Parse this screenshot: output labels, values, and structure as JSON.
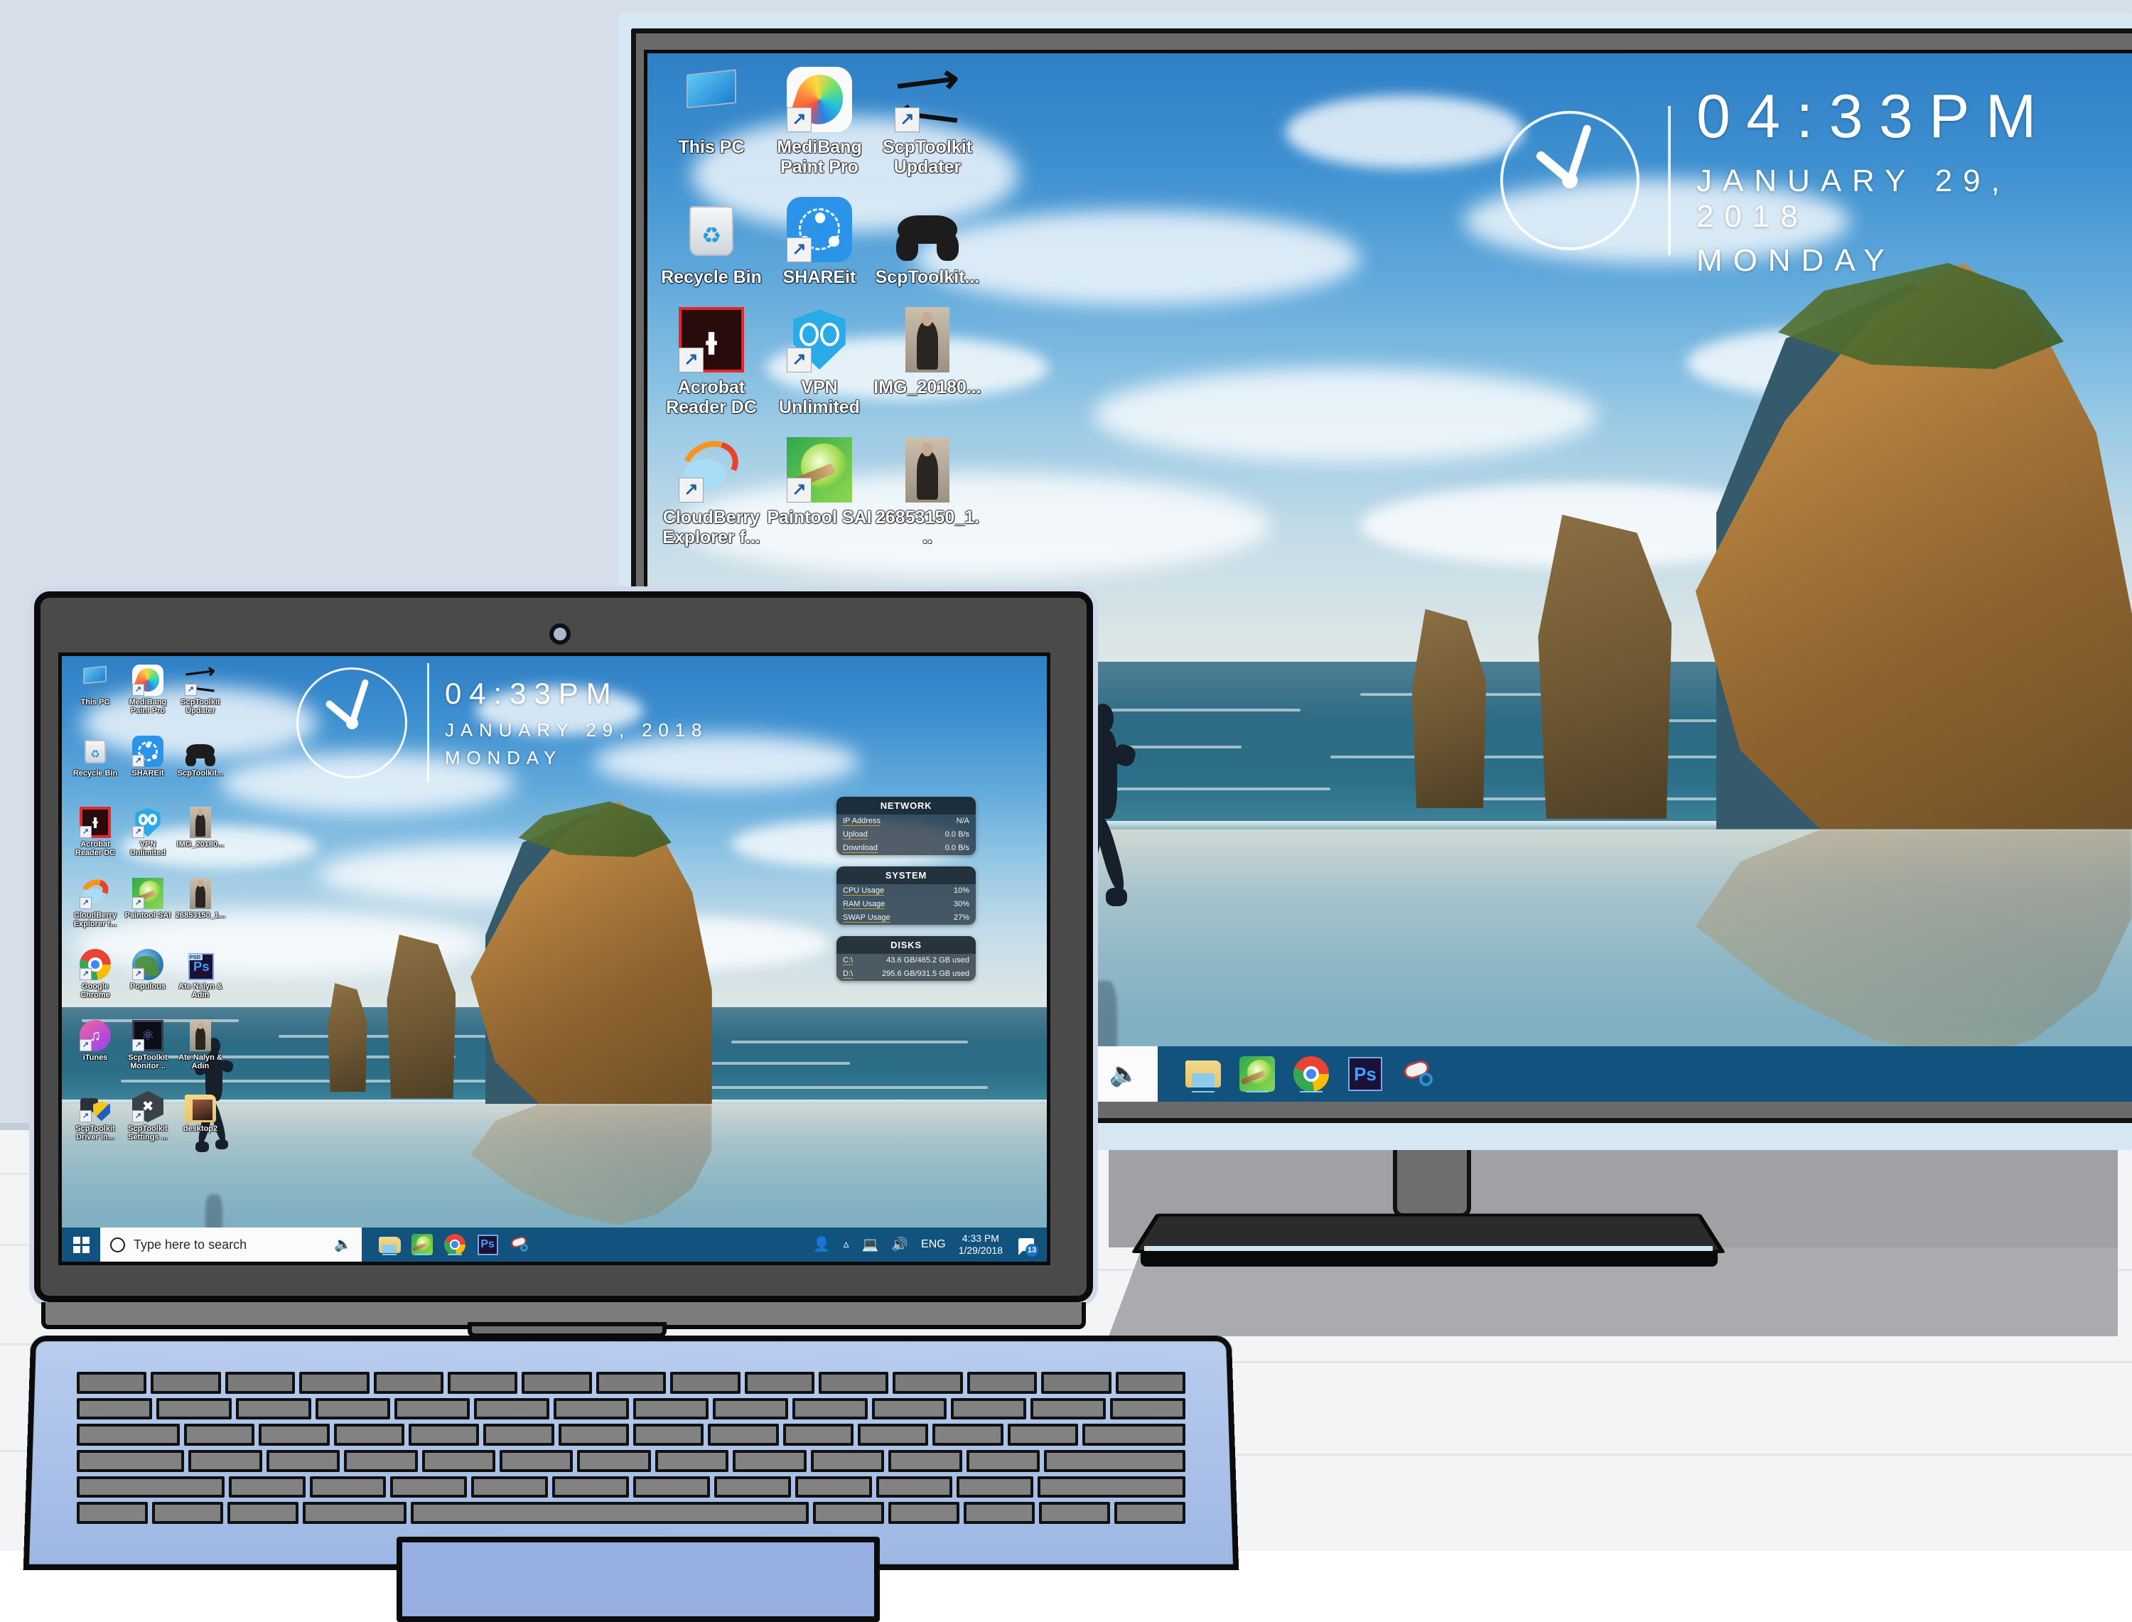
{
  "scene": {
    "title": "Windows 10 desktop mirrored on external monitor and laptop",
    "wall_color": "#d6dfe9",
    "desk_color": "#f3f4f6",
    "laptop_chassis_color": "#b9ccee",
    "taskbar_color": "#12527e",
    "wallpaper_name": "Wharariki Beach"
  },
  "clock_widget": {
    "time": "04:33",
    "ampm": "PM",
    "time_full": "04:33PM",
    "date": "JANUARY 29, 2018",
    "date_partial": "JANUARY",
    "day": "MONDAY"
  },
  "desktop_icons": [
    {
      "label": "This PC",
      "icon": "this-pc-icon",
      "shortcut": false
    },
    {
      "label": "MediBang Paint Pro",
      "icon": "medibang-paint-pro-icon",
      "shortcut": true
    },
    {
      "label": "ScpToolkit Updater",
      "icon": "scptoolkit-updater-icon",
      "shortcut": true
    },
    {
      "label": "Recycle Bin",
      "icon": "recycle-bin-icon",
      "shortcut": false
    },
    {
      "label": "SHAREit",
      "icon": "shareit-icon",
      "shortcut": true
    },
    {
      "label": "ScpToolkit...",
      "icon": "gamepad-icon",
      "shortcut": false
    },
    {
      "label": "Acrobat Reader DC",
      "icon": "acrobat-reader-dc-icon",
      "shortcut": true
    },
    {
      "label": "VPN Unlimited",
      "icon": "vpn-unlimited-icon",
      "shortcut": true
    },
    {
      "label": "IMG_20180...",
      "icon": "photo-thumbnail-icon",
      "shortcut": false
    },
    {
      "label": "CloudBerry Explorer f...",
      "icon": "cloudberry-explorer-icon",
      "shortcut": true
    },
    {
      "label": "Paintool SAI",
      "icon": "paintool-sai-icon",
      "shortcut": true
    },
    {
      "label": "26853150_1...",
      "icon": "photo-thumbnail-icon",
      "shortcut": false
    },
    {
      "label": "Google Chrome",
      "icon": "google-chrome-icon",
      "shortcut": true
    },
    {
      "label": "Populous",
      "icon": "populous-icon",
      "shortcut": true
    },
    {
      "label": "Ate Nalyn & Adin",
      "icon": "photoshop-psd-file-icon",
      "shortcut": false
    },
    {
      "label": "iTunes",
      "icon": "itunes-icon",
      "shortcut": true
    },
    {
      "label": "ScpToolkit Monitor ..",
      "icon": "scptoolkit-monitor-icon",
      "shortcut": true
    },
    {
      "label": "Ate Nalyn & Adin",
      "icon": "photo-thumbnail-icon",
      "shortcut": false
    },
    {
      "label": "ScpToolkit Driver In...",
      "icon": "scptoolkit-driver-installer-icon",
      "shortcut": true
    },
    {
      "label": "ScpToolkit Settings ...",
      "icon": "scptoolkit-settings-icon",
      "shortcut": true
    },
    {
      "label": "desktop2",
      "icon": "folder-icon",
      "shortcut": false
    }
  ],
  "system_monitor": {
    "panels": [
      {
        "title": "NETWORK",
        "rows": [
          {
            "key": "IP Address",
            "value": "N/A"
          },
          {
            "key": "Upload",
            "value": "0.0 B/s"
          },
          {
            "key": "Download",
            "value": "0.0 B/s"
          }
        ]
      },
      {
        "title": "SYSTEM",
        "rows": [
          {
            "key": "CPU Usage",
            "value": "10%"
          },
          {
            "key": "RAM Usage",
            "value": "30%"
          },
          {
            "key": "SWAP Usage",
            "value": "27%"
          }
        ]
      },
      {
        "title": "DISKS",
        "rows": [
          {
            "key": "C:\\",
            "value": "43.6 GB/465.2 GB used"
          },
          {
            "key": "D:\\",
            "value": "295.6 GB/931.5 GB used"
          }
        ]
      }
    ]
  },
  "taskbar": {
    "start_label": "Start",
    "search_placeholder": "Type here to search",
    "cortana_icon": "cortana-circle-icon",
    "mic_icon": "microphone-icon",
    "pinned": [
      {
        "name": "file-explorer-icon",
        "label": "File Explorer"
      },
      {
        "name": "paintool-sai-icon",
        "label": "Paintool SAI"
      },
      {
        "name": "google-chrome-icon",
        "label": "Google Chrome"
      },
      {
        "name": "photoshop-icon",
        "label": "Adobe Photoshop"
      },
      {
        "name": "snipping-tool-icon",
        "label": "Snipping Tool"
      }
    ],
    "tray": {
      "people_icon": "people-icon",
      "chevron_icon": "show-hidden-icons-chevron",
      "network_icon": "network-icon",
      "volume_icon": "volume-icon",
      "language": "ENG",
      "time": "4:33 PM",
      "date": "1/29/2018",
      "action_center_icon": "action-center-icon",
      "notification_count": "13"
    }
  }
}
